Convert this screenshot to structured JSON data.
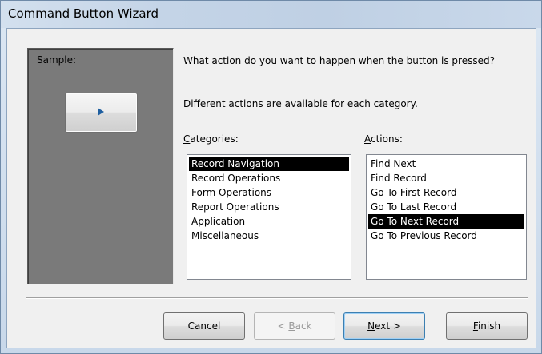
{
  "window": {
    "title": "Command Button Wizard"
  },
  "sample": {
    "label": "Sample:",
    "button_icon": "play-right-icon"
  },
  "prompt": {
    "question": "What action do you want to happen when the button is pressed?",
    "info": "Different actions are available for each category."
  },
  "categories": {
    "label_hotkey": "C",
    "label_rest": "ategories:",
    "items": [
      {
        "label": "Record Navigation",
        "selected": true
      },
      {
        "label": "Record Operations",
        "selected": false
      },
      {
        "label": "Form Operations",
        "selected": false
      },
      {
        "label": "Report Operations",
        "selected": false
      },
      {
        "label": "Application",
        "selected": false
      },
      {
        "label": "Miscellaneous",
        "selected": false
      }
    ]
  },
  "actions": {
    "label_hotkey": "A",
    "label_rest": "ctions:",
    "items": [
      {
        "label": "Find Next",
        "selected": false
      },
      {
        "label": "Find Record",
        "selected": false
      },
      {
        "label": "Go To First Record",
        "selected": false
      },
      {
        "label": "Go To Last Record",
        "selected": false
      },
      {
        "label": "Go To Next Record",
        "selected": true
      },
      {
        "label": "Go To Previous Record",
        "selected": false
      }
    ]
  },
  "buttons": {
    "cancel": "Cancel",
    "back_pre": "< ",
    "back_hotkey": "B",
    "back_rest": "ack",
    "next_hotkey": "N",
    "next_rest": "ext >",
    "finish_hotkey": "F",
    "finish_rest": "inish"
  },
  "colors": {
    "selection_bg": "#000000",
    "sample_panel": "#7a7a7a",
    "title_bar": "#c4d4e7"
  }
}
